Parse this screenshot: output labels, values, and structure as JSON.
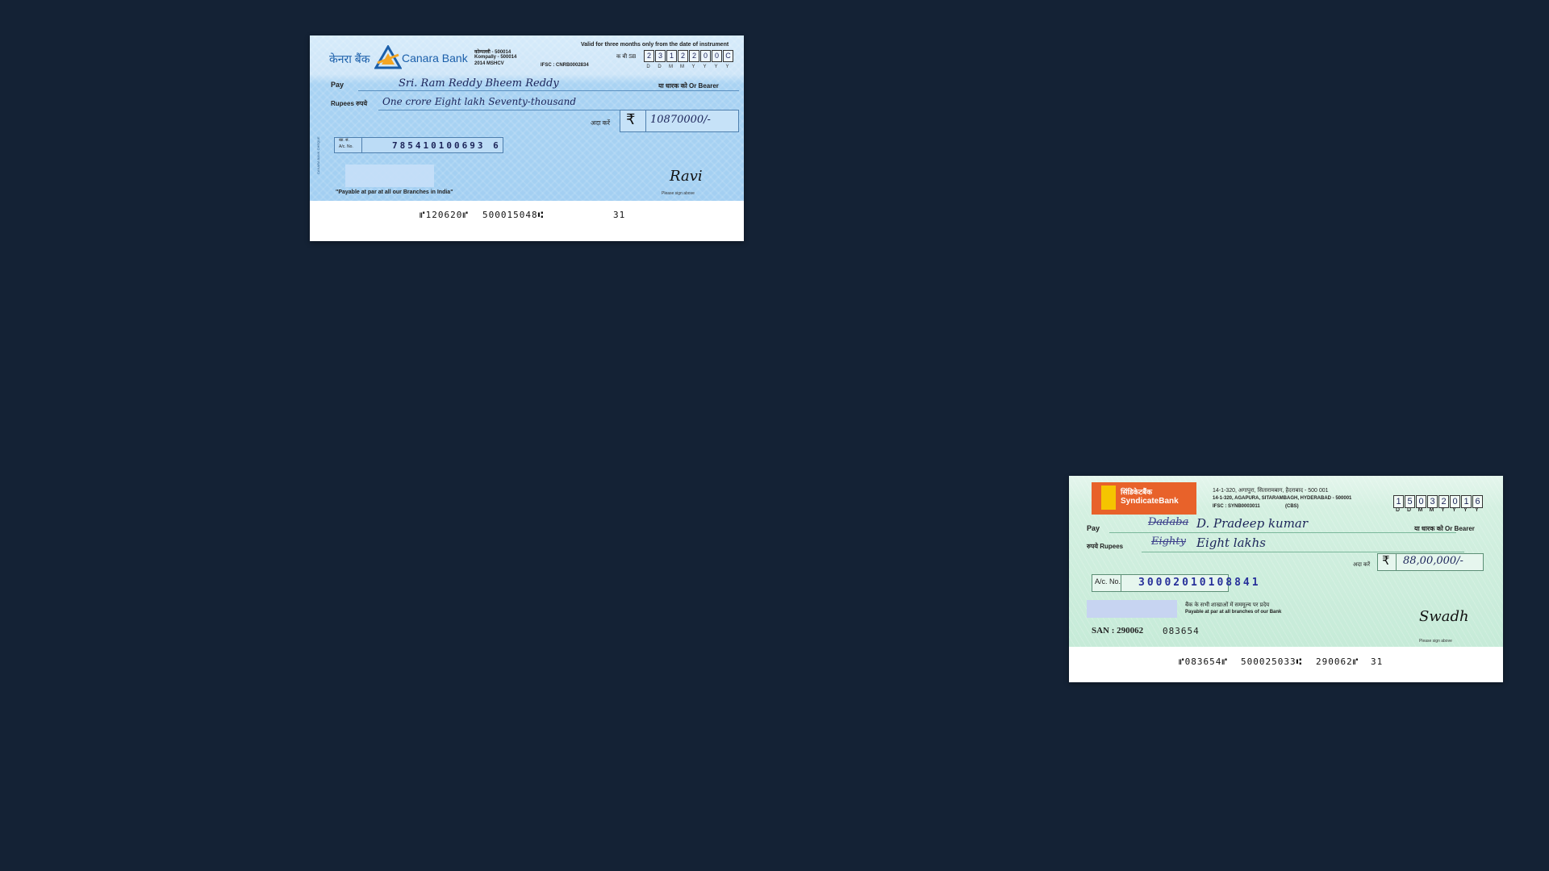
{
  "canara": {
    "logo_hindi": "केनरा बैंक",
    "logo_english": "Canara Bank",
    "branch_code": "कोम्पल्ली - 500014",
    "branch_name": "Kompally - 500014",
    "branch_extra": "2014 MSHCV",
    "ifsc": "IFSC : CNRB0002834",
    "validity": "Valid for three months only from the date of instrument",
    "sb_label": "क बी  SB",
    "date_digits": [
      "2",
      "3",
      "1",
      "2",
      "2",
      "0",
      "0",
      "C"
    ],
    "date_labels": [
      "D",
      "D",
      "M",
      "M",
      "Y",
      "Y",
      "Y",
      "Y"
    ],
    "pay_label": "Pay",
    "payee": "Sri. Ram Reddy Bheem Reddy",
    "bearer": "या धारक को Or Bearer",
    "rupees_label": "Rupees रुपये",
    "amount_words": "One crore Eight lakh Seventy-thousand",
    "ada_karen": "अदा करें",
    "rupee_symbol": "₹",
    "amount_figures": "10870000/-",
    "account_label_hindi": "खा. सं.",
    "account_label": "A/c. No.",
    "account_number": "785410100693 6",
    "payable_note": "\"Payable at par at all our Branches in India\"",
    "sign_hint": "Please sign above",
    "signature": "Ravi",
    "micr_cheque": "⑈120620⑈",
    "micr_code": "500015048⑆",
    "micr_tx": "31"
  },
  "syndicate": {
    "logo_hindi": "सिंडिकेटबैंक",
    "logo_english": "SyndicateBank",
    "address_hindi": "14-1-320, अगापुरा, सितारामबाग, हैदराबाद - 500 001",
    "address": "14-1-320, AGAPURA, SITARAMBAGH, HYDERABAD - 500001",
    "ifsc": "IFSC : SYNB0003011",
    "cbs": "(CBS)",
    "date_digits": [
      "1",
      "5",
      "0",
      "3",
      "2",
      "0",
      "1",
      "6"
    ],
    "date_labels": [
      "D",
      "D",
      "M",
      "M",
      "Y",
      "Y",
      "Y",
      "Y"
    ],
    "pay_label": "Pay",
    "payee": "D. Pradeep kumar",
    "payee_strike": "Dadaba",
    "bearer": "या धारक को Or Bearer",
    "rupees_label": "रुपये Rupees",
    "amount_words": "Eight lakhs",
    "amount_strike": "Eighty",
    "ada_karen": "अदा करें",
    "rupee_symbol": "₹",
    "amount_figures": "88,00,000/-",
    "account_label": "A/c. No.",
    "account_number": "30002010108841",
    "payable_hindi": "बैंक के सभी शाखाओं में सममूल्य पर प्रदेय",
    "payable_english": "Payable at par at all branches of our Bank",
    "san_label": "SAN : 290062",
    "san_number": "083654",
    "sign_hint": "Please sign above",
    "signature": "Swadh",
    "micr_cheque": "⑈083654⑈",
    "micr_code": "500025033⑆",
    "micr_san": "290062⑈",
    "micr_tx": "31"
  },
  "colors": {
    "background": "#142235",
    "canara_blue": "#a3cff2",
    "syndicate_green": "#c6ebd8"
  }
}
